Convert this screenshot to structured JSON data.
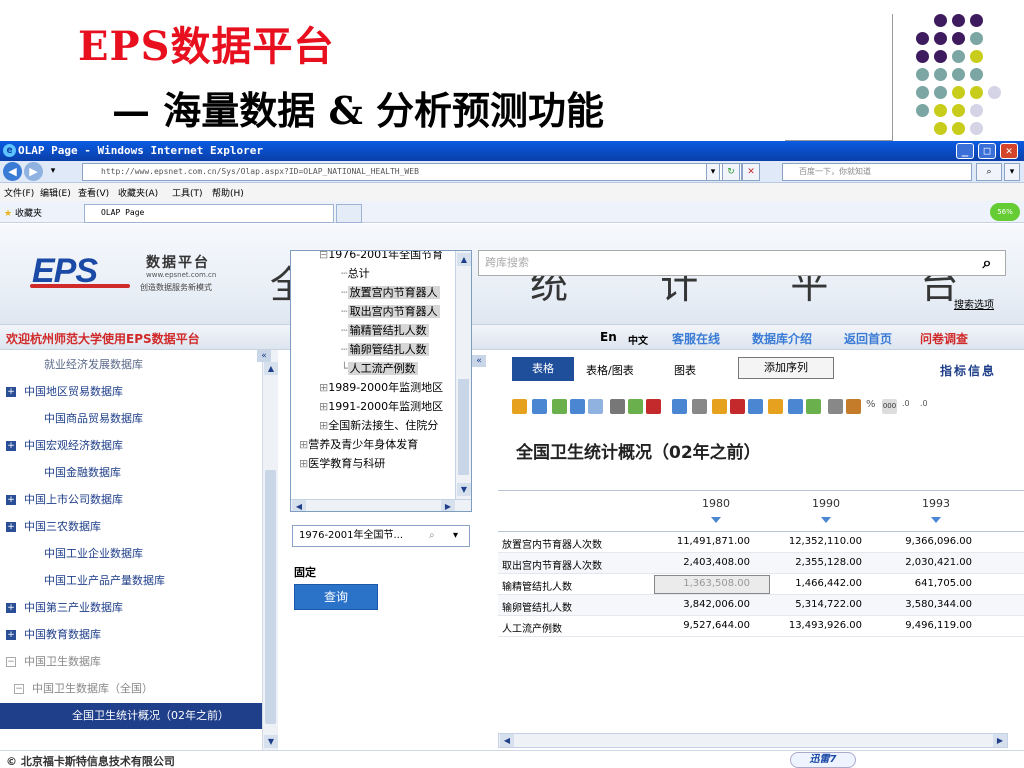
{
  "slide": {
    "title": "EPS数据平台",
    "subtitle": "— 海量数据 & 分析预测功能"
  },
  "colors": {
    "title_red": "#e8101e",
    "dot_purple": "#3d1b5e",
    "dot_teal": "#7ba6a3",
    "dot_yellow": "#c8cc1a",
    "dot_lavender": "#d5d3e6",
    "link_blue": "#1f3f8a",
    "accent_red": "#d12a2a"
  },
  "browser": {
    "window_title": "OLAP Page - Windows Internet Explorer",
    "address": "http://www.epsnet.com.cn/Sys/Olap.aspx?ID=OLAP_NATIONAL_HEALTH_WEB",
    "search_placeholder": "百度一下，你就知道",
    "menu": [
      "文件(F)",
      "编辑(E)",
      "查看(V)",
      "收藏夹(A)",
      "工具(T)",
      "帮助(H)"
    ],
    "favorites_label": "收藏夹",
    "tab_title": "OLAP Page",
    "zoom_badge": "56%"
  },
  "header": {
    "logo_text": "EPS",
    "logo_name": "数据平台",
    "logo_url": "www.epsnet.com.cn",
    "logo_slogan": "创造数据服务新模式",
    "banner_text": "全 球 统 计 平 台",
    "search_placeholder": "跨库搜索",
    "search_options": "搜索选项"
  },
  "nav": {
    "welcome": "欢迎杭州师范大学使用EPS数据平台",
    "links": [
      {
        "label": "En",
        "color": "#000000"
      },
      {
        "label": "中文",
        "color": "#000000"
      },
      {
        "label": "客服在线",
        "color": "#3a7bd5"
      },
      {
        "label": "数据库介绍",
        "color": "#3a7bd5"
      },
      {
        "label": "返回首页",
        "color": "#3a7bd5"
      },
      {
        "label": "问卷调查",
        "color": "#d12a2a"
      }
    ]
  },
  "sidebar": {
    "items": [
      {
        "label": "就业经济发展数据库",
        "type": "child"
      },
      {
        "label": "中国地区贸易数据库",
        "type": "plus"
      },
      {
        "label": "中国商品贸易数据库",
        "type": "child"
      },
      {
        "label": "中国宏观经济数据库",
        "type": "plus"
      },
      {
        "label": "中国金融数据库",
        "type": "child"
      },
      {
        "label": "中国上市公司数据库",
        "type": "plus"
      },
      {
        "label": "中国三农数据库",
        "type": "plus"
      },
      {
        "label": "中国工业企业数据库",
        "type": "child"
      },
      {
        "label": "中国工业产品产量数据库",
        "type": "child"
      },
      {
        "label": "中国第三产业数据库",
        "type": "plus"
      },
      {
        "label": "中国教育数据库",
        "type": "plus"
      },
      {
        "label": "中国卫生数据库",
        "type": "minus"
      },
      {
        "label": "中国卫生数据库（全国）",
        "type": "minus2"
      },
      {
        "label": "全国卫生统计概况（02年之前）",
        "type": "active"
      }
    ]
  },
  "tree": {
    "items": [
      {
        "label": "1976-2001年全国节育",
        "indent": 28,
        "prefix": "⊟"
      },
      {
        "label": "总计",
        "indent": 50,
        "prefix": "┄"
      },
      {
        "label": "放置宫内节育器人",
        "indent": 50,
        "prefix": "┄",
        "hi": true
      },
      {
        "label": "取出宫内节育器人",
        "indent": 50,
        "prefix": "┄",
        "hi": true
      },
      {
        "label": "输精管结扎人数",
        "indent": 50,
        "prefix": "┄",
        "hi": true
      },
      {
        "label": "输卵管结扎人数",
        "indent": 50,
        "prefix": "┄",
        "hi": true
      },
      {
        "label": "人工流产例数",
        "indent": 50,
        "prefix": "└",
        "hi": true
      },
      {
        "label": "1989-2000年监测地区",
        "indent": 28,
        "prefix": "⊞"
      },
      {
        "label": "1991-2000年监测地区",
        "indent": 28,
        "prefix": "⊞"
      },
      {
        "label": "全国新法接生、住院分",
        "indent": 28,
        "prefix": "⊞"
      },
      {
        "label": "营养及青少年身体发育",
        "indent": 8,
        "prefix": "⊞"
      },
      {
        "label": "医学教育与科研",
        "indent": 8,
        "prefix": "⊞"
      }
    ],
    "combo_value": "1976-2001年全国节...",
    "fixed_label": "固定",
    "query_button": "查询"
  },
  "main": {
    "tabs": [
      {
        "label": "表格",
        "active": true
      },
      {
        "label": "表格/图表"
      },
      {
        "label": "图表"
      }
    ],
    "add_series": "添加序列",
    "indicator_info": "指标信息",
    "report_title": "全国卫生统计概况（02年之前）",
    "years": [
      "1980",
      "1990",
      "1993"
    ],
    "rows": [
      {
        "label": "放置宫内节育器人次数",
        "values": [
          "11,491,871.00",
          "12,352,110.00",
          "9,366,096.00"
        ]
      },
      {
        "label": "取出宫内节育器人次数",
        "values": [
          "2,403,408.00",
          "2,355,128.00",
          "2,030,421.00"
        ]
      },
      {
        "label": "输精管结扎人数",
        "values": [
          "1,363,508.00",
          "1,466,442.00",
          "641,705.00"
        ],
        "selected_col": 0
      },
      {
        "label": "输卵管结扎人数",
        "values": [
          "3,842,006.00",
          "5,314,722.00",
          "3,580,344.00"
        ]
      },
      {
        "label": "人工流产例数",
        "values": [
          "9,527,644.00",
          "13,493,926.00",
          "9,496,119.00"
        ]
      }
    ]
  },
  "footer": {
    "copyright": "© 北京福卡斯特信息技术有限公司",
    "badge": "迅雷7"
  }
}
